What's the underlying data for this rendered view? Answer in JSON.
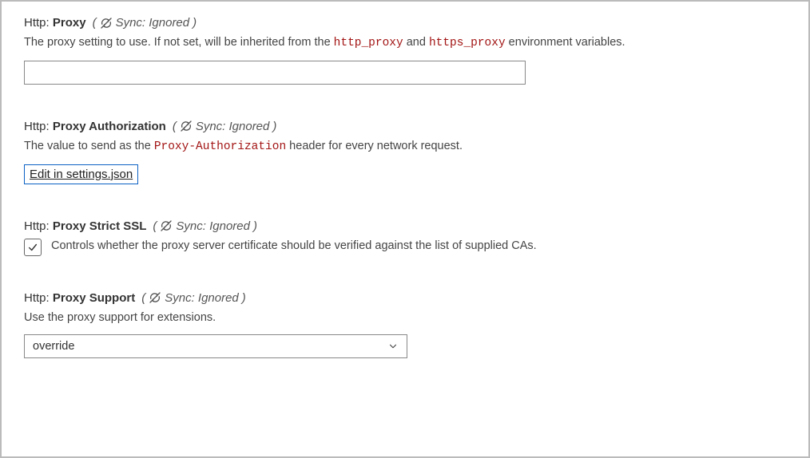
{
  "sync_label": "Sync: Ignored",
  "settings": {
    "proxy": {
      "prefix": "Http:",
      "name": "Proxy",
      "desc_before": "The proxy setting to use. If not set, will be inherited from the ",
      "code1": "http_proxy",
      "desc_mid": " and ",
      "code2": "https_proxy",
      "desc_after": " environment variables.",
      "value": ""
    },
    "proxyAuth": {
      "prefix": "Http:",
      "name": "Proxy Authorization",
      "desc_before": "The value to send as the ",
      "code1": "Proxy-Authorization",
      "desc_after": " header for every network request.",
      "link_label": "Edit in settings.json"
    },
    "proxyStrictSSL": {
      "prefix": "Http:",
      "name": "Proxy Strict SSL",
      "checked": true,
      "desc": "Controls whether the proxy server certificate should be verified against the list of supplied CAs."
    },
    "proxySupport": {
      "prefix": "Http:",
      "name": "Proxy Support",
      "desc": "Use the proxy support for extensions.",
      "value": "override"
    }
  }
}
